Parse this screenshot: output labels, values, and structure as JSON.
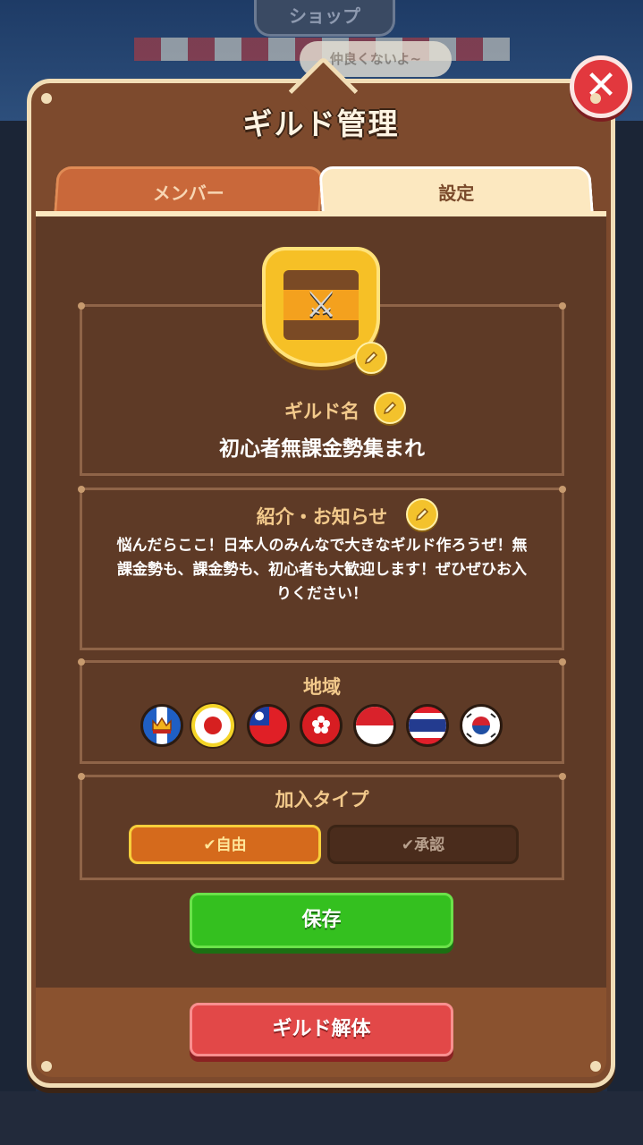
{
  "background": {
    "shop_sign": "ショップ",
    "speech_bubble": "仲良くないよ~"
  },
  "dialog": {
    "title": "ギルド管理",
    "close_symbol": "✕"
  },
  "tabs": [
    {
      "label": "メンバー",
      "active": false
    },
    {
      "label": "設定",
      "active": true
    }
  ],
  "guild": {
    "name_label": "ギルド名",
    "name": "初心者無課金勢集まれ",
    "intro_label": "紹介・お知らせ",
    "intro_text": "悩んだらここ！日本人のみんなで大きなギルド作ろうぜ！無課金勢も、課金勢も、初心者も大歓迎します！ぜひぜひお入りください！"
  },
  "region": {
    "label": "地域",
    "flags": [
      {
        "icon": "crown-flag-icon",
        "selected": false
      },
      {
        "icon": "japan-flag-icon",
        "selected": true
      },
      {
        "icon": "taiwan-flag-icon",
        "selected": false
      },
      {
        "icon": "hongkong-flag-icon",
        "selected": false
      },
      {
        "icon": "indonesia-flag-icon",
        "selected": false
      },
      {
        "icon": "thailand-flag-icon",
        "selected": false
      },
      {
        "icon": "korea-flag-icon",
        "selected": false
      }
    ]
  },
  "join_type": {
    "label": "加入タイプ",
    "options": [
      {
        "label": "自由",
        "selected": true
      },
      {
        "label": "承認",
        "selected": false
      }
    ]
  },
  "buttons": {
    "save": "保存",
    "disband": "ギルド解体"
  },
  "colors": {
    "panel": "#7d4a2d",
    "save": "#34c01f",
    "disband": "#e24848",
    "accent": "#f3c22c"
  }
}
